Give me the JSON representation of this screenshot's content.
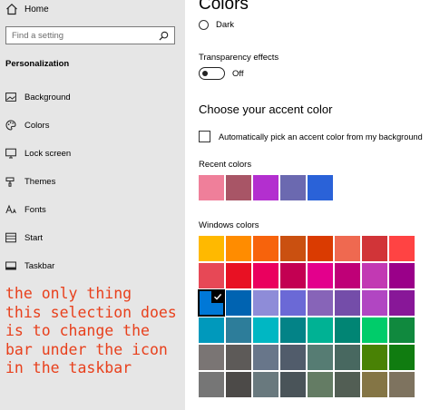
{
  "sidebar": {
    "home_label": "Home",
    "search_placeholder": "Find a setting",
    "section_title": "Personalization",
    "items": [
      {
        "label": "Background",
        "icon": "picture-icon"
      },
      {
        "label": "Colors",
        "icon": "palette-icon"
      },
      {
        "label": "Lock screen",
        "icon": "monitor-icon"
      },
      {
        "label": "Themes",
        "icon": "brush-icon"
      },
      {
        "label": "Fonts",
        "icon": "font-icon"
      },
      {
        "label": "Start",
        "icon": "start-menu-icon"
      },
      {
        "label": "Taskbar",
        "icon": "taskbar-icon"
      }
    ]
  },
  "annotation": "the only thing\nthis selection does\nis to change the\nbar under the icon\nin the taskbar",
  "main": {
    "title": "Colors",
    "mode_option": "Dark",
    "transparency_label": "Transparency effects",
    "transparency_state": "Off",
    "accent_heading": "Choose your accent color",
    "auto_pick_label": "Automatically pick an accent color from my background",
    "recent_label": "Recent colors",
    "recent_colors": [
      "#ef7f9a",
      "#a85566",
      "#b32fcf",
      "#6b69b0",
      "#2a62d8"
    ],
    "windows_label": "Windows colors",
    "windows_colors": [
      [
        "#ffb900",
        "#ff8c00",
        "#f7630c",
        "#ca5010",
        "#da3b01",
        "#ef6950",
        "#d13438",
        "#ff4343"
      ],
      [
        "#e74856",
        "#e81123",
        "#ea005e",
        "#c30052",
        "#e3008c",
        "#bf0077",
        "#c239b3",
        "#9a0089"
      ],
      [
        "#0078d7",
        "#0063b1",
        "#8e8cd8",
        "#6b69d6",
        "#8764b8",
        "#744da9",
        "#b146c2",
        "#881798"
      ],
      [
        "#0099bc",
        "#2d7d9a",
        "#00b7c3",
        "#038387",
        "#00b294",
        "#018574",
        "#00cc6a",
        "#10893e"
      ],
      [
        "#7a7574",
        "#5d5a58",
        "#68768a",
        "#515c6b",
        "#567c73",
        "#486860",
        "#498205",
        "#107c10"
      ],
      [
        "#767676",
        "#4c4a48",
        "#69797e",
        "#4a5459",
        "#647c64",
        "#525e54",
        "#847545",
        "#7e735f"
      ]
    ],
    "selected_color": "#0078d7"
  }
}
